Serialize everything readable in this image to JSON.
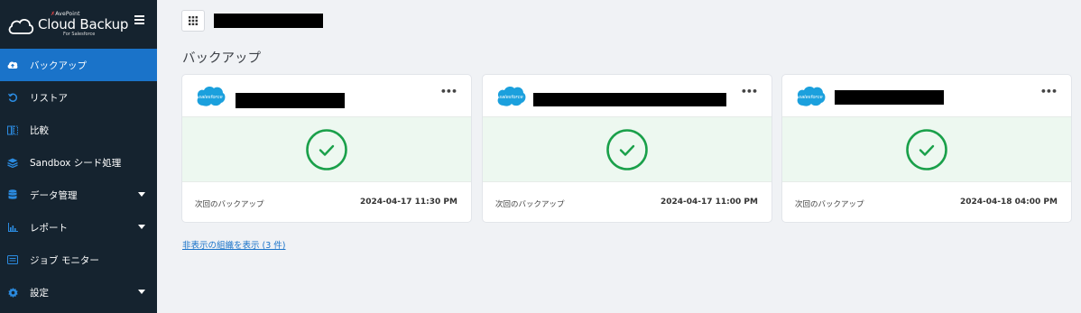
{
  "brand": {
    "company": "AvePoint",
    "product": "Cloud Backup",
    "subtitle": "For Salesforce"
  },
  "sidebar": {
    "items": [
      {
        "label": "バックアップ",
        "icon": "cloud-upload-icon",
        "active": true
      },
      {
        "label": "リストア",
        "icon": "restore-icon"
      },
      {
        "label": "比較",
        "icon": "compare-icon"
      },
      {
        "label": "Sandbox シード処理",
        "icon": "layers-icon"
      },
      {
        "label": "データ管理",
        "icon": "database-icon",
        "expandable": true
      },
      {
        "label": "レポート",
        "icon": "chart-icon",
        "expandable": true
      },
      {
        "label": "ジョブ モニター",
        "icon": "monitor-icon"
      },
      {
        "label": "設定",
        "icon": "gear-icon",
        "expandable": true
      }
    ]
  },
  "main": {
    "title": "バックアップ",
    "cards": [
      {
        "logo": "salesforce",
        "status": "success",
        "next_label": "次回のバックアップ",
        "next_date": "2024-04-17 11:30 PM"
      },
      {
        "logo": "salesforce",
        "status": "success",
        "next_label": "次回のバックアップ",
        "next_date": "2024-04-17 11:00 PM"
      },
      {
        "logo": "salesforce",
        "status": "success",
        "next_label": "次回のバックアップ",
        "next_date": "2024-04-18 04:00 PM"
      }
    ],
    "more_label": "•••",
    "hidden_link": "非表示の組織を表示 (3 件)"
  },
  "colors": {
    "sidebar_bg": "#15232f",
    "active": "#1a73c9",
    "success": "#1aa04a",
    "salesforce": "#1ba0dd"
  }
}
